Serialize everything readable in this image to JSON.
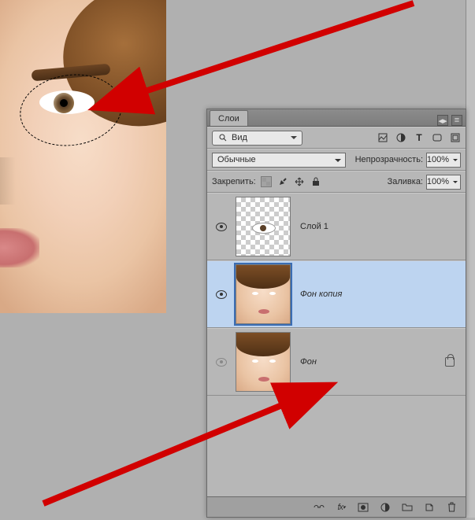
{
  "panel": {
    "tab_label": "Слои",
    "search_placeholder": "Вид",
    "blend_mode": "Обычные",
    "opacity_label": "Непрозрачность:",
    "opacity_value": "100%",
    "fill_label": "Заливка:",
    "fill_value": "100%",
    "lock_label": "Закрепить:"
  },
  "layers": [
    {
      "name": "Слой 1",
      "visible": true,
      "locked": false,
      "selected": false,
      "thumb": "eye"
    },
    {
      "name": "Фон копия",
      "visible": true,
      "locked": false,
      "selected": true,
      "thumb": "face",
      "italic": true
    },
    {
      "name": "Фон",
      "visible": true,
      "locked": true,
      "selected": false,
      "thumb": "face",
      "italic": true
    }
  ],
  "icons": {
    "search": "search-icon",
    "filter_image": "image-filter-icon",
    "filter_adjust": "adjust-filter-icon",
    "filter_text": "text-filter-icon",
    "filter_shape": "shape-filter-icon",
    "filter_smart": "smart-filter-icon",
    "menu": "panel-menu-icon",
    "collapse": "collapse-icon",
    "lock_transparent": "lock-transparent-icon",
    "lock_paint": "lock-paint-icon",
    "lock_move": "lock-move-icon",
    "lock_all": "lock-all-icon",
    "link": "link-icon",
    "fx": "fx-icon",
    "mask": "mask-icon",
    "adjustment": "adjustment-icon",
    "group": "group-icon",
    "new": "new-layer-icon",
    "trash": "trash-icon"
  }
}
